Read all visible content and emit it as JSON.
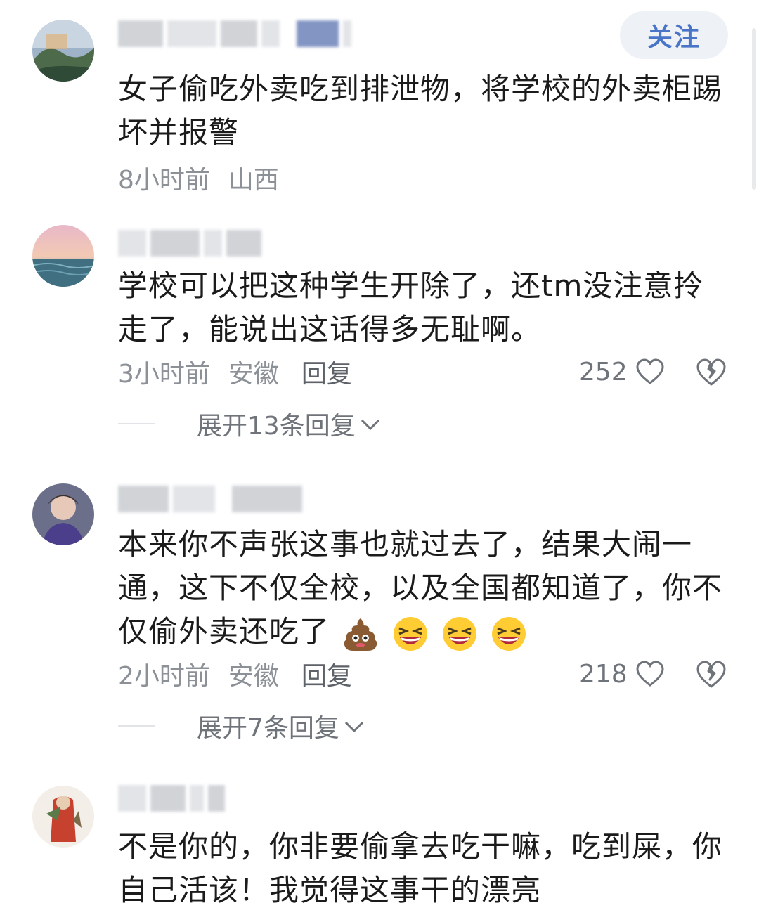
{
  "follow_button": "关注",
  "comments": [
    {
      "text": "女子偷吃外卖吃到排泄物，将学校的外卖柜踢坏并报警",
      "time": "8小时前",
      "location": "山西"
    },
    {
      "text": "学校可以把这种学生开除了，还tm没注意拎走了，能说出这话得多无耻啊。",
      "time": "3小时前",
      "location": "安徽",
      "reply": "回复",
      "likes": "252",
      "expand": "展开13条回复"
    },
    {
      "text": "本来你不声张这事也就过去了，结果大闹一通，这下不仅全校，以及全国都知道了，你不仅偷外卖还吃了",
      "time": "2小时前",
      "location": "安徽",
      "reply": "回复",
      "likes": "218",
      "expand": "展开7条回复"
    },
    {
      "text": "不是你的，你非要偷拿去吃干嘛，吃到屎，你自己活该！我觉得这事干的漂亮"
    }
  ],
  "icons": {
    "like": "heart-outline-icon",
    "dislike": "broken-heart-icon",
    "expand": "chevron-down-icon",
    "emoji_poop": "poop-emoji-icon",
    "emoji_laugh": "grinning-squint-emoji-icon"
  },
  "colors": {
    "follow_text": "#4a74c8",
    "follow_bg": "#eef1f6",
    "meta_text": "#8c9097"
  }
}
